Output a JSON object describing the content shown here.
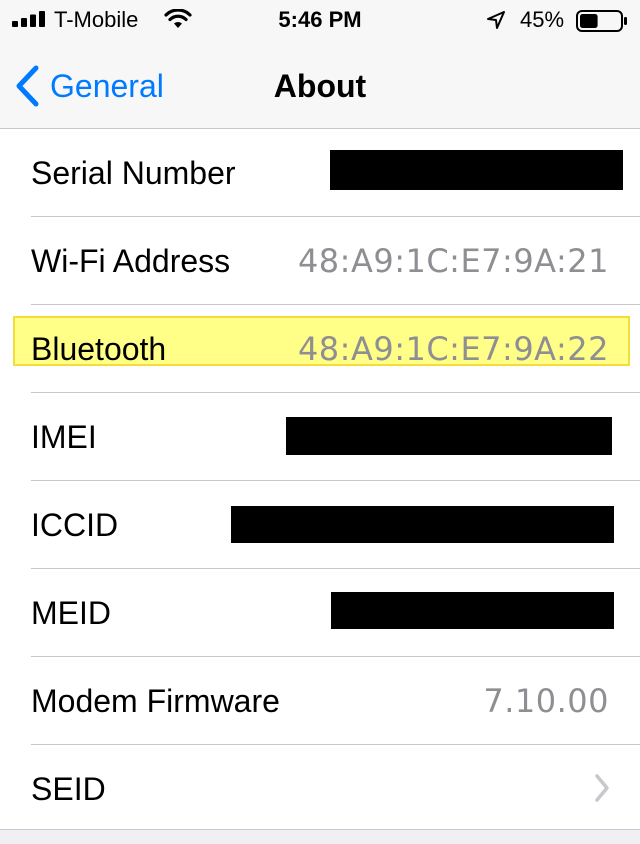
{
  "status_bar": {
    "carrier": "T-Mobile",
    "time": "5:46 PM",
    "battery_percent": "45%",
    "battery_level": 0.45,
    "icons": [
      "signal-icon",
      "wifi-icon",
      "location-arrow-icon",
      "battery-icon"
    ]
  },
  "nav": {
    "back_label": "General",
    "title": "About"
  },
  "rows": [
    {
      "label": "Serial Number",
      "value": ""
    },
    {
      "label": "Wi-Fi Address",
      "value": "48:A9:1C:E7:9A:21"
    },
    {
      "label": "Bluetooth",
      "value": "48:A9:1C:E7:9A:22"
    },
    {
      "label": "IMEI",
      "value": ""
    },
    {
      "label": "ICCID",
      "value": ""
    },
    {
      "label": "MEID",
      "value": ""
    },
    {
      "label": "Modem Firmware",
      "value": "7.10.00"
    },
    {
      "label": "SEID",
      "value": ""
    }
  ],
  "colors": {
    "accent": "#007aff",
    "secondary_text": "#8e8e93",
    "highlight": "#ffff5a",
    "redaction": "#000000"
  }
}
